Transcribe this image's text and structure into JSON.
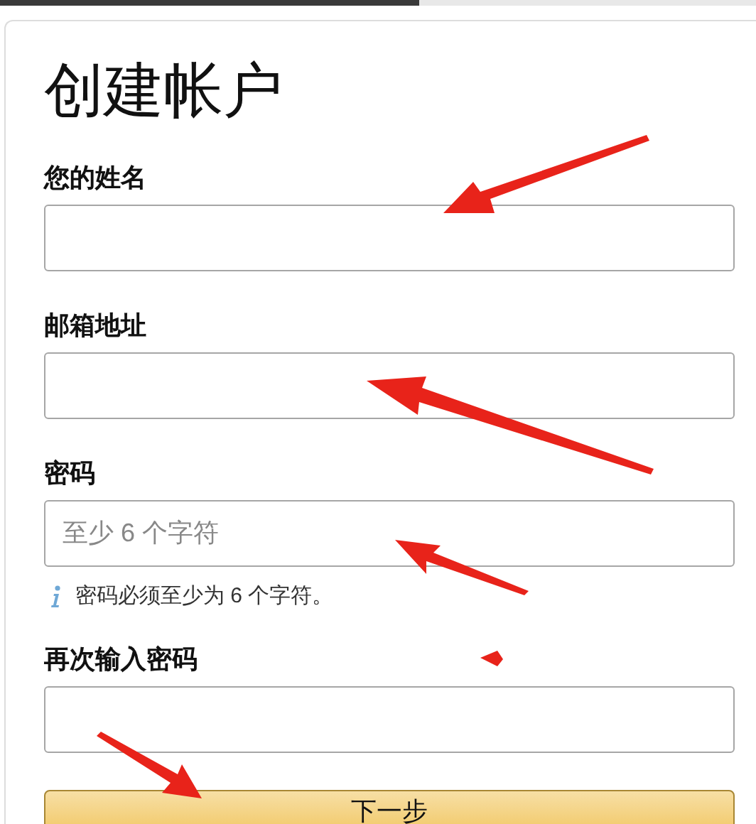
{
  "title": "创建帐户",
  "fields": [
    {
      "label": "您的姓名"
    },
    {
      "label": "邮箱地址"
    },
    {
      "label": "密码",
      "placeholder": "至少 6 个字符",
      "hint": "密码必须至少为 6 个字符。"
    },
    {
      "label": "再次输入密码"
    }
  ],
  "submit_button": "下一步"
}
